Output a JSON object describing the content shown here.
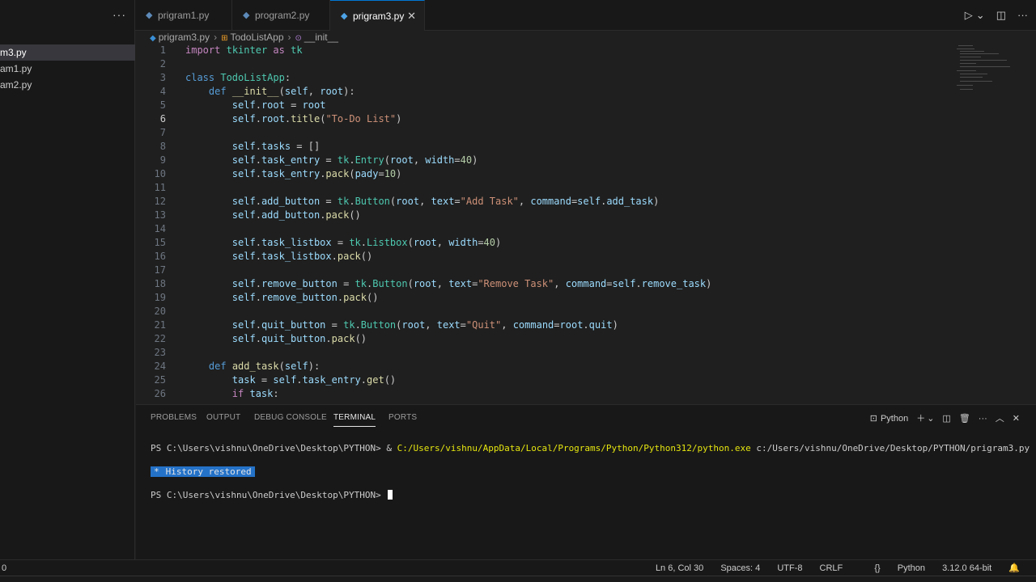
{
  "sidebar": {
    "more": "···",
    "files": [
      {
        "label": "m3.py",
        "active": true
      },
      {
        "label": "am1.py",
        "active": false
      },
      {
        "label": "am2.py",
        "active": false
      }
    ]
  },
  "tabs": [
    {
      "label": "prigram1.py"
    },
    {
      "label": "program2.py"
    },
    {
      "label": "prigram3.py"
    }
  ],
  "tab_close": "✕",
  "tabbar_actions": {
    "run": "▷",
    "run_menu": "⌄",
    "split": "◫",
    "more": "···"
  },
  "breadcrumb": {
    "file": "prigram3.py",
    "class": "TodoListApp",
    "method": "__init__",
    "sep": "›"
  },
  "editor": {
    "current_line": 6,
    "lines": [
      {
        "n": "1"
      },
      {
        "n": "2"
      },
      {
        "n": "3"
      },
      {
        "n": "4"
      },
      {
        "n": "5"
      },
      {
        "n": "6"
      },
      {
        "n": "7"
      },
      {
        "n": "8"
      },
      {
        "n": "9"
      },
      {
        "n": "10"
      },
      {
        "n": "11"
      },
      {
        "n": "12"
      },
      {
        "n": "13"
      },
      {
        "n": "14"
      },
      {
        "n": "15"
      },
      {
        "n": "16"
      },
      {
        "n": "17"
      },
      {
        "n": "18"
      },
      {
        "n": "19"
      },
      {
        "n": "20"
      },
      {
        "n": "21"
      },
      {
        "n": "22"
      },
      {
        "n": "23"
      },
      {
        "n": "24"
      },
      {
        "n": "25"
      },
      {
        "n": "26"
      }
    ]
  },
  "panel": {
    "tabs": [
      "PROBLEMS",
      "OUTPUT",
      "DEBUG CONSOLE",
      "TERMINAL",
      "PORTS"
    ],
    "active_tab": "TERMINAL",
    "shell": "Python",
    "terminal": {
      "prompt1": "PS C:\\Users\\vishnu\\OneDrive\\Desktop\\PYTHON> & ",
      "exe": "C:/Users/vishnu/AppData/Local/Programs/Python/Python312/python.exe",
      "arg": " c:/Users/vishnu/OneDrive/Desktop/PYTHON/prigram3.py",
      "history_star": "*",
      "history": "History restored",
      "prompt2": "PS C:\\Users\\vishnu\\OneDrive\\Desktop\\PYTHON> "
    }
  },
  "status": {
    "left": "0",
    "position": "Ln 6, Col 30",
    "spaces": "Spaces: 4",
    "encoding": "UTF-8",
    "eol": "CRLF",
    "language": "Python",
    "interpreter": "3.12.0 64-bit"
  },
  "colors": {
    "accent": "#0078d4",
    "history_bg": "#2472c8",
    "path_yellow": "#e5e510"
  }
}
